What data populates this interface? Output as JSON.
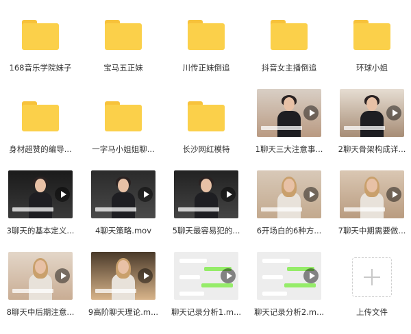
{
  "files": [
    {
      "label": "168音乐学院妹子",
      "kind": "folder",
      "icon": "folder-icon"
    },
    {
      "label": "宝马五正妹",
      "kind": "folder",
      "icon": "folder-icon"
    },
    {
      "label": "川传正妹倒追",
      "kind": "folder",
      "icon": "folder-icon"
    },
    {
      "label": "抖音女主播倒追",
      "kind": "folder",
      "icon": "folder-icon"
    },
    {
      "label": "环球小姐",
      "kind": "folder",
      "icon": "folder-icon"
    },
    {
      "label": "身材超赞的编导...",
      "kind": "folder",
      "icon": "folder-icon"
    },
    {
      "label": "一字马小姐姐聊...",
      "kind": "folder",
      "icon": "folder-icon"
    },
    {
      "label": "长沙网红模特",
      "kind": "folder",
      "icon": "folder-icon"
    },
    {
      "label": "1聊天三大注意事...",
      "kind": "video",
      "icon": "play-icon"
    },
    {
      "label": "2聊天骨架构成详...",
      "kind": "video",
      "icon": "play-icon"
    },
    {
      "label": "3聊天的基本定义...",
      "kind": "video",
      "icon": "play-icon"
    },
    {
      "label": "4聊天策略.mov",
      "kind": "video",
      "icon": "play-icon"
    },
    {
      "label": "5聊天最容易犯的...",
      "kind": "video",
      "icon": "play-icon"
    },
    {
      "label": "6开场白的6种方...",
      "kind": "video",
      "icon": "play-icon"
    },
    {
      "label": "7聊天中期需要做...",
      "kind": "video",
      "icon": "play-icon"
    },
    {
      "label": "8聊天中后期注意...",
      "kind": "video",
      "icon": "play-icon"
    },
    {
      "label": "9高阶聊天理论.m...",
      "kind": "video",
      "icon": "play-icon"
    },
    {
      "label": "聊天记录分析1.m...",
      "kind": "chat",
      "icon": "play-icon"
    },
    {
      "label": "聊天记录分析2.m...",
      "kind": "chat",
      "icon": "play-icon"
    },
    {
      "label": "上传文件",
      "kind": "upload",
      "icon": "plus-icon"
    }
  ],
  "colors": {
    "folder": "#fbd04a",
    "folder_tab": "#f7c23b",
    "text": "#333333"
  }
}
